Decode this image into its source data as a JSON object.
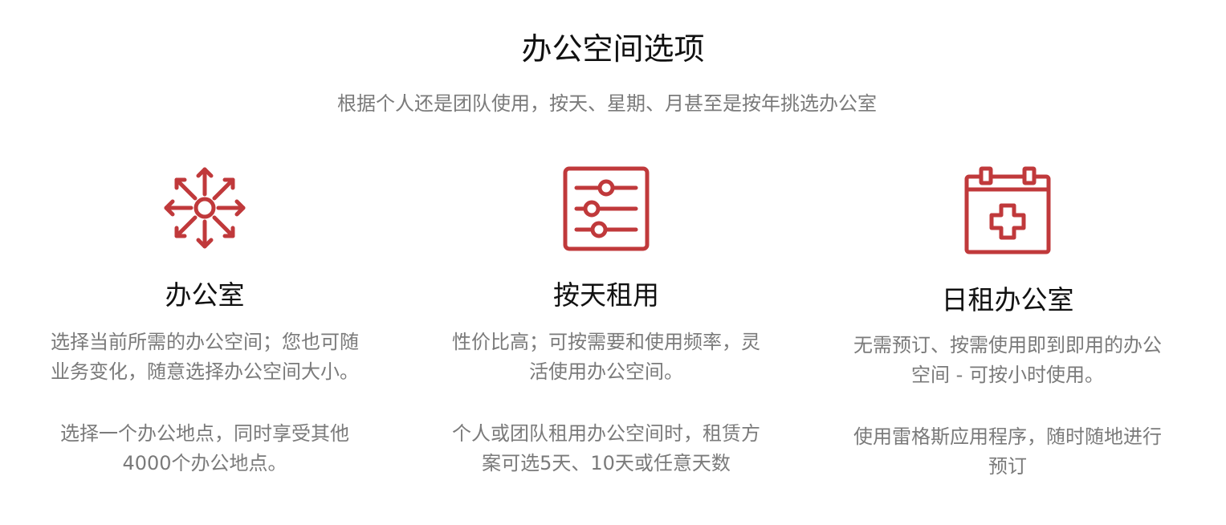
{
  "header": {
    "title": "办公空间选项",
    "subtitle": "根据个人还是团队使用，按天、星期、月甚至是按年挑选办公室"
  },
  "accent_color": "#c0393b",
  "options": [
    {
      "icon": "expand-arrows-icon",
      "title": "办公室",
      "desc_a": [
        "选择当前所需的办公空间；您也可随",
        "业务变化，随意选择办公空间大小。"
      ],
      "desc_b": [
        "选择一个办公地点，同时享受其他",
        "4000个办公地点。"
      ]
    },
    {
      "icon": "sliders-icon",
      "title": "按天租用",
      "desc_a": [
        "性价比高；可按需要和使用频率，灵",
        "活使用办公空间。"
      ],
      "desc_b": [
        "个人或团队租用办公空间时，租赁方",
        "案可选5天、10天或任意天数"
      ]
    },
    {
      "icon": "calendar-plus-icon",
      "title": "日租办公室",
      "desc_a": [
        "无需预订、按需使用即到即用的办公",
        "空间 - 可按小时使用。"
      ],
      "desc_b": [
        "使用雷格斯应用程序，随时随地进行",
        "预订"
      ]
    }
  ]
}
